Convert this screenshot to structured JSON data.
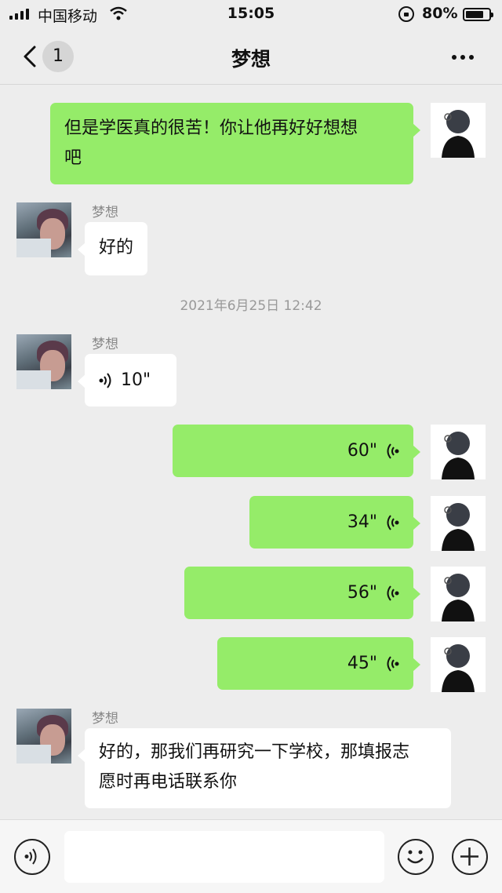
{
  "status_bar": {
    "carrier": "中国移动",
    "time": "15:05",
    "battery_percent_text": "80%",
    "battery_level": 0.8
  },
  "nav": {
    "back_badge": "1",
    "title": "梦想"
  },
  "timestamp": "2021年6月25日 12:42",
  "messages": [
    {
      "side": "right",
      "type": "text",
      "lines": [
        "但是学医真的很苦！你让他再好好想想",
        "吧"
      ]
    },
    {
      "side": "left",
      "type": "text",
      "sender": "梦想",
      "text": "好的"
    },
    {
      "side": "left",
      "type": "voice",
      "sender": "梦想",
      "duration": "10\""
    },
    {
      "side": "right",
      "type": "voice",
      "duration": "60\""
    },
    {
      "side": "right",
      "type": "voice",
      "duration": "34\""
    },
    {
      "side": "right",
      "type": "voice",
      "duration": "56\""
    },
    {
      "side": "right",
      "type": "voice",
      "duration": "45\""
    },
    {
      "side": "left",
      "type": "text",
      "sender": "梦想",
      "lines": [
        "好的，那我们再研究一下学校，那填报志",
        "愿时再电话联系你"
      ]
    }
  ],
  "colors": {
    "background": "#ededed",
    "bubble_self": "#95ec69",
    "bubble_other": "#ffffff"
  }
}
